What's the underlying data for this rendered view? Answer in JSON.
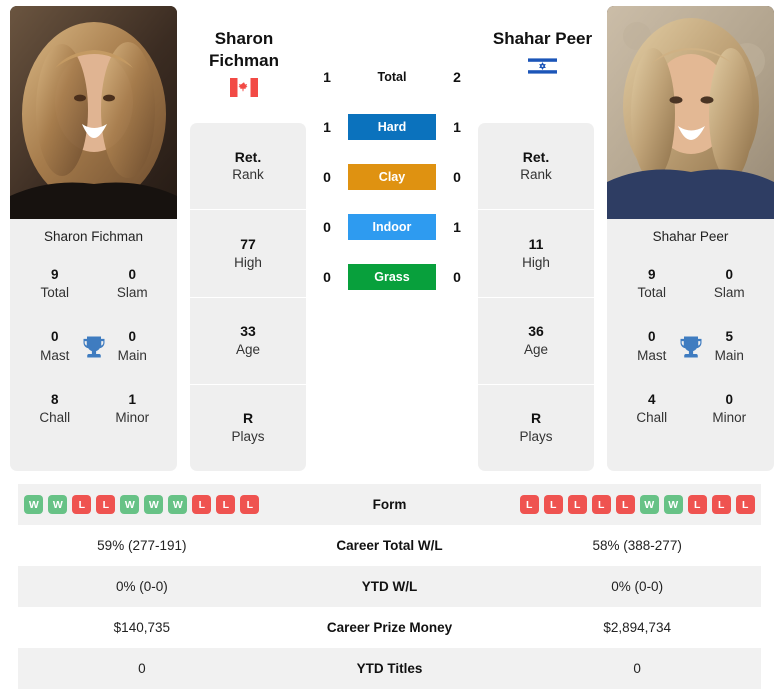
{
  "players": {
    "left": {
      "name_line1": "Sharon",
      "name_line2": "Fichman",
      "full_name": "Sharon Fichman",
      "flag": "canada-flag",
      "total_score": "1",
      "titles": [
        {
          "num": "9",
          "lbl": "Total"
        },
        {
          "num": "0",
          "lbl": "Slam"
        },
        {
          "num": "0",
          "lbl": "Mast"
        },
        {
          "num": "0",
          "lbl": "Main"
        },
        {
          "num": "8",
          "lbl": "Chall"
        },
        {
          "num": "1",
          "lbl": "Minor"
        }
      ],
      "stats": [
        {
          "num": "Ret.",
          "lbl": "Rank"
        },
        {
          "num": "77",
          "lbl": "High"
        },
        {
          "num": "33",
          "lbl": "Age"
        },
        {
          "num": "R",
          "lbl": "Plays"
        }
      ],
      "form": [
        "W",
        "W",
        "L",
        "L",
        "W",
        "W",
        "W",
        "L",
        "L",
        "L"
      ],
      "career_total_wl": "59% (277-191)",
      "ytd_wl": "0% (0-0)",
      "career_prize_money": "$140,735",
      "ytd_titles": "0"
    },
    "right": {
      "name_line1": "Shahar Peer",
      "name_line2": "",
      "full_name": "Shahar Peer",
      "flag": "israel-flag",
      "total_score": "2",
      "titles": [
        {
          "num": "9",
          "lbl": "Total"
        },
        {
          "num": "0",
          "lbl": "Slam"
        },
        {
          "num": "0",
          "lbl": "Mast"
        },
        {
          "num": "5",
          "lbl": "Main"
        },
        {
          "num": "4",
          "lbl": "Chall"
        },
        {
          "num": "0",
          "lbl": "Minor"
        }
      ],
      "stats": [
        {
          "num": "Ret.",
          "lbl": "Rank"
        },
        {
          "num": "11",
          "lbl": "High"
        },
        {
          "num": "36",
          "lbl": "Age"
        },
        {
          "num": "R",
          "lbl": "Plays"
        }
      ],
      "form": [
        "L",
        "L",
        "L",
        "L",
        "L",
        "W",
        "W",
        "L",
        "L",
        "L"
      ],
      "career_total_wl": "58% (388-277)",
      "ytd_wl": "0% (0-0)",
      "career_prize_money": "$2,894,734",
      "ytd_titles": "0"
    }
  },
  "surfaces": [
    {
      "label": "Total",
      "left": "1",
      "right": "2",
      "color": "transparent",
      "text_color": "#111111"
    },
    {
      "label": "Hard",
      "left": "1",
      "right": "1",
      "color": "#0b72bd",
      "text_color": "#ffffff"
    },
    {
      "label": "Clay",
      "left": "0",
      "right": "0",
      "color": "#df9211",
      "text_color": "#ffffff"
    },
    {
      "label": "Indoor",
      "left": "0",
      "right": "1",
      "color": "#2e9bf0",
      "text_color": "#ffffff"
    },
    {
      "label": "Grass",
      "left": "0",
      "right": "0",
      "color": "#08a03c",
      "text_color": "#ffffff"
    }
  ],
  "table": {
    "rows": [
      {
        "label": "Form",
        "key": "form",
        "type": "form"
      },
      {
        "label": "Career Total W/L",
        "key": "career_total_wl",
        "type": "text"
      },
      {
        "label": "YTD W/L",
        "key": "ytd_wl",
        "type": "text"
      },
      {
        "label": "Career Prize Money",
        "key": "career_prize_money",
        "type": "text"
      },
      {
        "label": "YTD Titles",
        "key": "ytd_titles",
        "type": "text"
      }
    ]
  },
  "colors": {
    "win_badge": "#67c286",
    "loss_badge": "#ef5350",
    "card_bg": "#efefef",
    "stripe": "#f1f1f1",
    "trophy": "#3f7cc0"
  }
}
